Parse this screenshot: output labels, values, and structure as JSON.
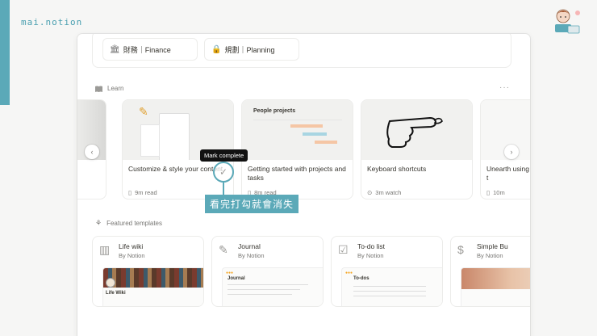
{
  "brand": {
    "text": "mai.notion"
  },
  "top_chips": [
    {
      "icon": "bank-icon",
      "label": "財務｜Finance"
    },
    {
      "icon": "suitcase-icon",
      "label": "規劃｜Planning"
    }
  ],
  "learn": {
    "heading": "Learn",
    "more": "···",
    "cards": [
      {
        "title": "Customize & style your content",
        "meta": "9m read",
        "meta_icon": "book-icon"
      },
      {
        "title": "Getting started with projects and tasks",
        "meta": "8m read",
        "meta_icon": "book-icon",
        "thumb_heading": "People projects"
      },
      {
        "title": "Keyboard shortcuts",
        "meta": "3m watch",
        "meta_icon": "play-icon"
      },
      {
        "title": "Unearth using t",
        "meta": "10m",
        "meta_icon": "book-icon"
      }
    ]
  },
  "tooltip": {
    "text": "Mark complete"
  },
  "callout": {
    "text": "看完打勾就會消失"
  },
  "featured": {
    "heading": "Featured templates",
    "templates": [
      {
        "name": "Life wiki",
        "by": "By Notion",
        "icon": "book-open-icon",
        "preview_label": "Life Wiki"
      },
      {
        "name": "Journal",
        "by": "By Notion",
        "icon": "pencil-square-icon",
        "preview_label": "Journal"
      },
      {
        "name": "To-do list",
        "by": "By Notion",
        "icon": "checkbox-icon",
        "preview_label": "To-dos"
      },
      {
        "name": "Simple Bu",
        "by": "By Notion",
        "icon": "money-icon"
      }
    ]
  },
  "colors": {
    "accent": "#5ba9b8",
    "text": "#37352f",
    "muted": "#787774"
  }
}
